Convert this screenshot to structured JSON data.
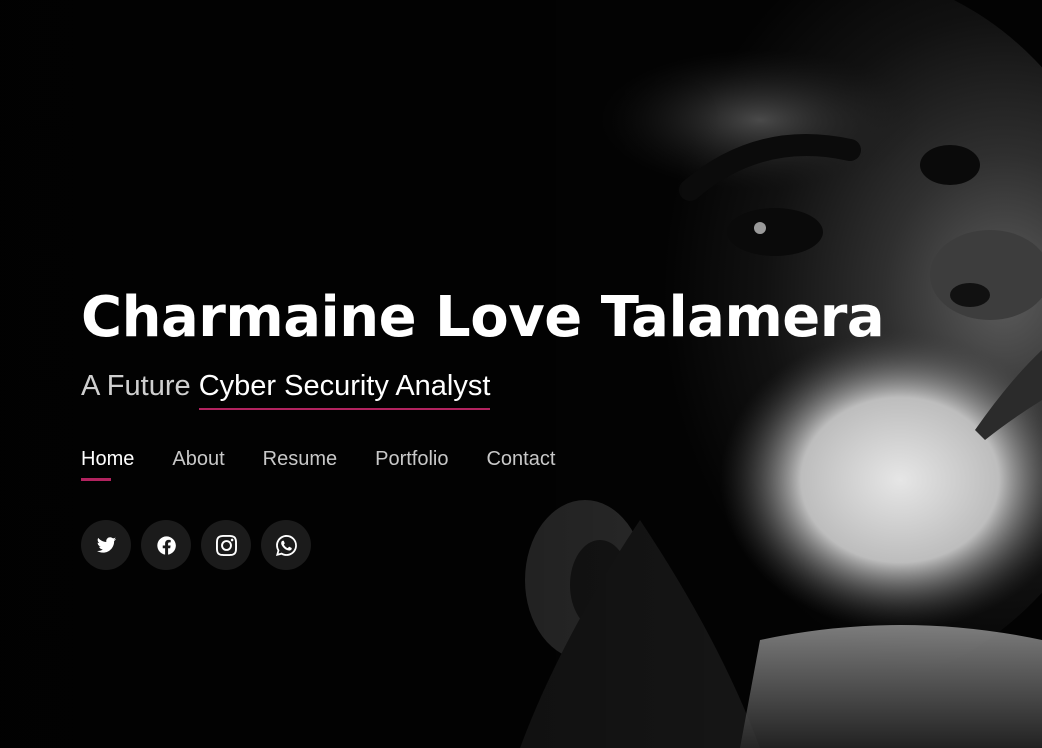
{
  "hero": {
    "name": "Charmaine Love Talamera",
    "tagline_prefix": "A Future",
    "tagline_typed": "Cyber Security Analyst",
    "background_image": "black-and-white-portrait-of-woman-looking-up"
  },
  "nav": {
    "items": [
      {
        "label": "Home",
        "active": true
      },
      {
        "label": "About",
        "active": false
      },
      {
        "label": "Resume",
        "active": false
      },
      {
        "label": "Portfolio",
        "active": false
      },
      {
        "label": "Contact",
        "active": false
      }
    ]
  },
  "socials": [
    {
      "icon": "twitter-icon"
    },
    {
      "icon": "facebook-icon"
    },
    {
      "icon": "instagram-icon"
    },
    {
      "icon": "whatsapp-icon"
    }
  ],
  "colors": {
    "accent": "#b2235f",
    "background": "#000000",
    "text_primary": "#ffffff",
    "text_secondary": "#c8c8c8"
  }
}
